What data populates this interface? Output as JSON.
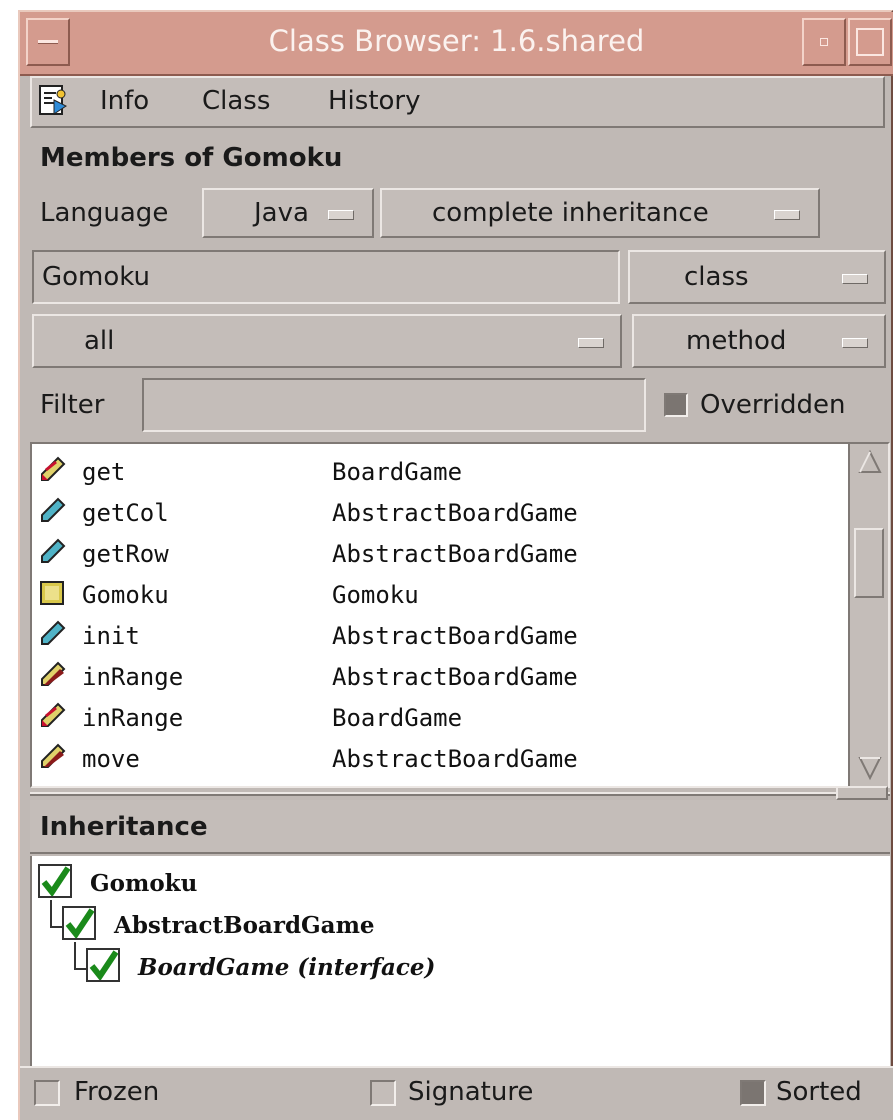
{
  "window": {
    "title": "Class Browser: 1.6.shared"
  },
  "menu": {
    "items": [
      "Info",
      "Class",
      "History"
    ]
  },
  "members": {
    "heading": "Members of Gomoku",
    "language_label": "Language",
    "language_value": "Java",
    "inheritance_value": "complete inheritance",
    "class_name": "Gomoku",
    "kind_value": "class",
    "visibility_value": "all",
    "member_type_value": "method",
    "filter_label": "Filter",
    "filter_value": "",
    "overridden_label": "Overridden"
  },
  "member_list": [
    {
      "name": "get",
      "owner": "BoardGame",
      "icon": "interface-method-icon"
    },
    {
      "name": "getCol",
      "owner": "AbstractBoardGame",
      "icon": "method-icon"
    },
    {
      "name": "getRow",
      "owner": "AbstractBoardGame",
      "icon": "method-icon"
    },
    {
      "name": "Gomoku",
      "owner": "Gomoku",
      "icon": "constructor-icon"
    },
    {
      "name": "init",
      "owner": "AbstractBoardGame",
      "icon": "method-icon"
    },
    {
      "name": "inRange",
      "owner": "AbstractBoardGame",
      "icon": "abstract-method-icon"
    },
    {
      "name": "inRange",
      "owner": "BoardGame",
      "icon": "interface-method-icon"
    },
    {
      "name": "move",
      "owner": "AbstractBoardGame",
      "icon": "abstract-method-icon"
    }
  ],
  "inheritance": {
    "heading": "Inheritance",
    "tree": [
      {
        "label": "Gomoku",
        "checked": true
      },
      {
        "label": "AbstractBoardGame",
        "checked": true
      },
      {
        "label": "BoardGame (interface)",
        "checked": true
      }
    ]
  },
  "footer": {
    "frozen_label": "Frozen",
    "signature_label": "Signature",
    "sorted_label": "Sorted"
  },
  "colors": {
    "title_bar": "#d49b8e",
    "panel": "#c0b9b5",
    "check": "#1a8a1a"
  }
}
